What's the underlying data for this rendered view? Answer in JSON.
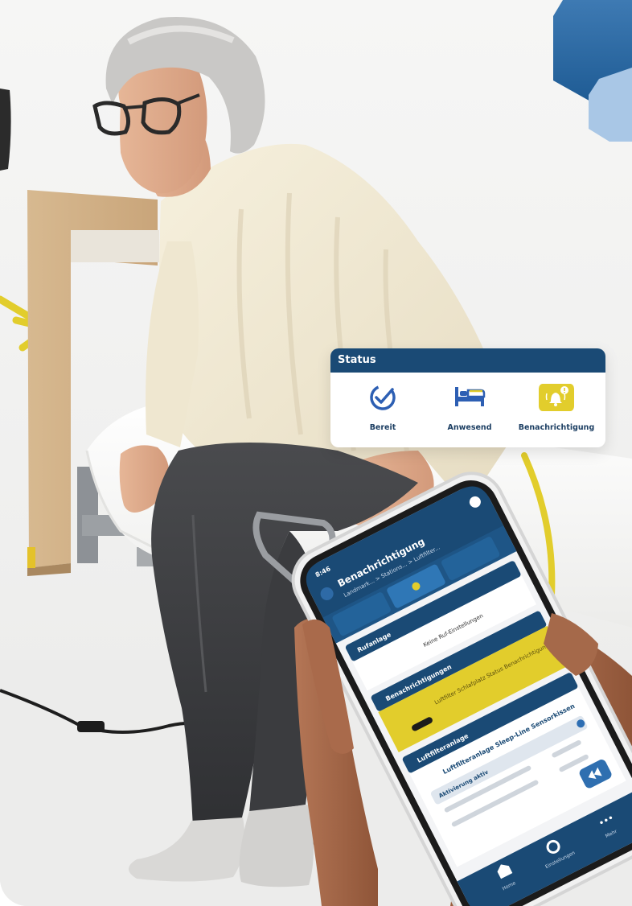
{
  "status_card": {
    "title": "Status",
    "items": [
      {
        "label": "Bereit",
        "icon": "check-circle-icon",
        "active": false
      },
      {
        "label": "Anwesend",
        "icon": "bed-occupied-icon",
        "active": false
      },
      {
        "label": "Benachrichtigung",
        "icon": "bell-alert-icon",
        "active": true
      }
    ]
  },
  "phone": {
    "time": "8:46",
    "header_title": "Benachrichtigung",
    "breadcrumb": "Landmark... > Stations... > Luftfilter...",
    "section_ruf": "Rufanlage",
    "ruf_value": "Keine Ruf-Einstellungen",
    "section_notifications": "Benachrichtigungen",
    "notification_text": "Luftfilter Schlafplatz Status Benachrichtigung",
    "section_device": "Luftfilteranlage",
    "device_name": "Luftfilteranlage Sleep-Line Sensorkissen",
    "sub_section": "Aktivierung aktiv",
    "nav_home": "Home",
    "nav_settings": "Einstellungen",
    "nav_more": "Mehr"
  },
  "colors": {
    "brand_blue": "#1a4a75",
    "accent_yellow": "#e2cd2c",
    "icon_blue": "#2d5fb3"
  }
}
